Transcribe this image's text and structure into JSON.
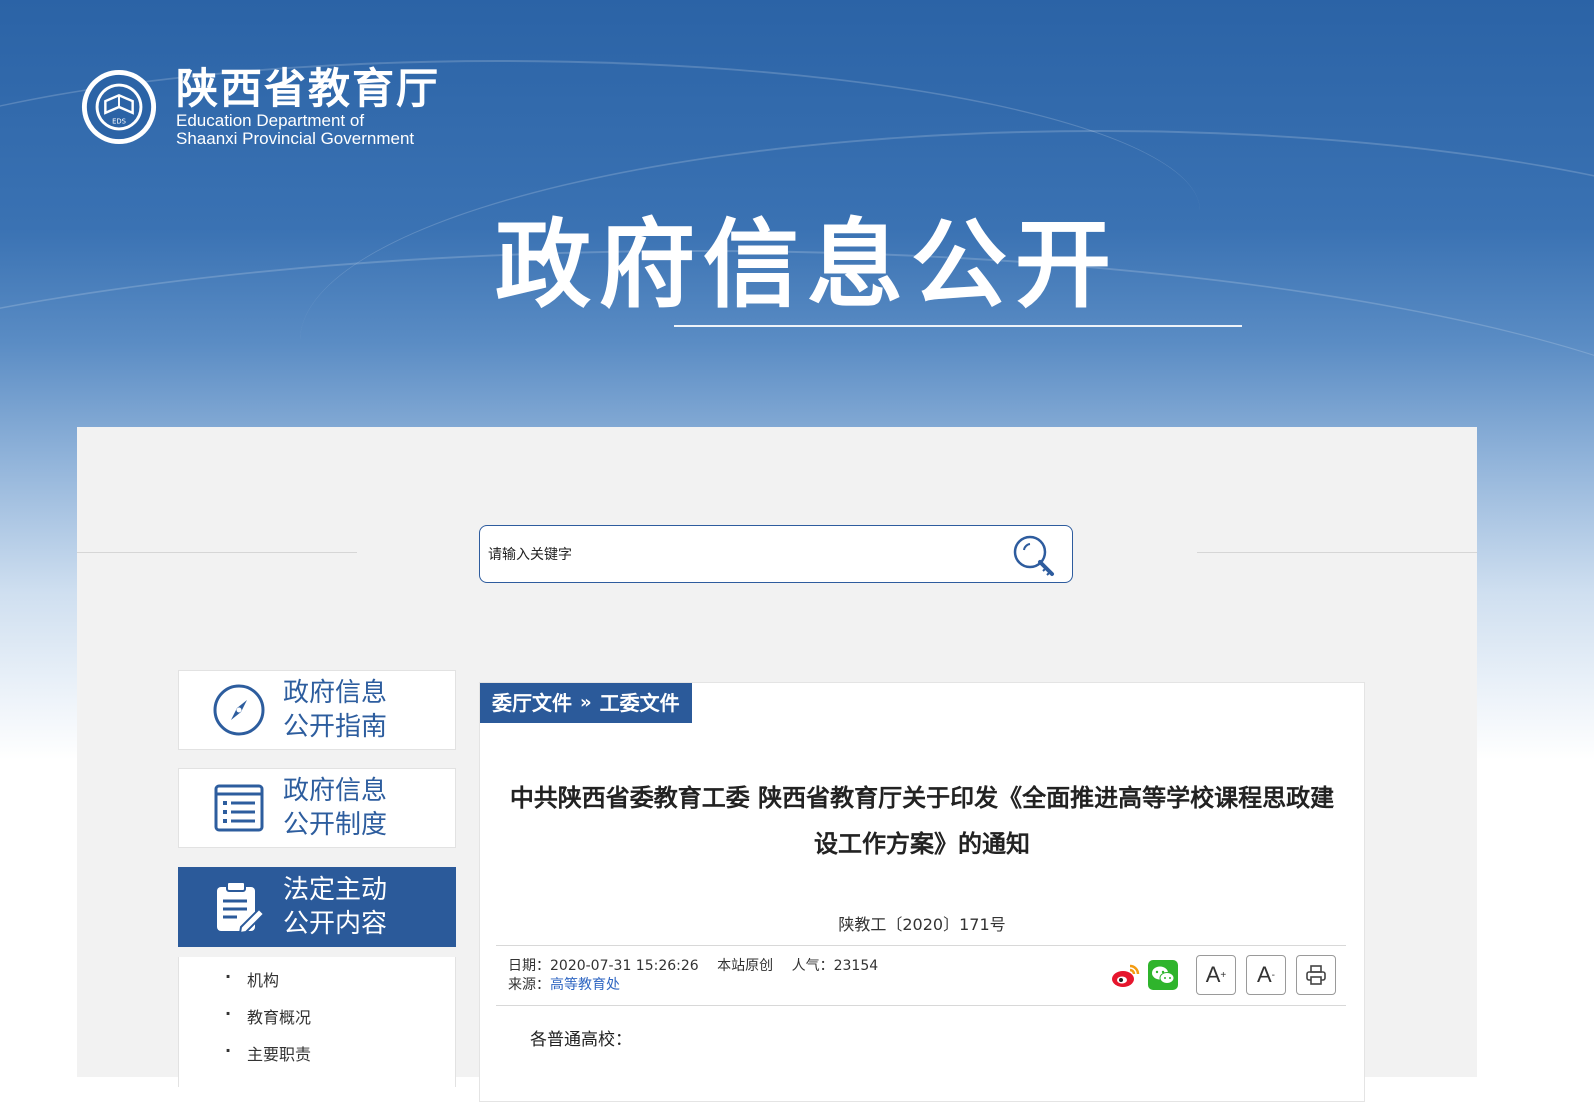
{
  "header": {
    "org_name_cn": "陕西省教育厅",
    "org_name_en_line1": "Education Department of",
    "org_name_en_line2": "Shaanxi Provincial Government",
    "emblem_text": "EDS",
    "banner_title": "政府信息公开"
  },
  "search": {
    "placeholder": "请输入关键字",
    "icon": "search-icon"
  },
  "sidebar": {
    "items": [
      {
        "label_line1": "政府信息",
        "label_line2": "公开指南",
        "icon": "compass-icon",
        "active": false
      },
      {
        "label_line1": "政府信息",
        "label_line2": "公开制度",
        "icon": "list-icon",
        "active": false
      },
      {
        "label_line1": "法定主动",
        "label_line2": "公开内容",
        "icon": "clipboard-edit-icon",
        "active": true
      }
    ],
    "sub_items": [
      "机构",
      "教育概况",
      "主要职责"
    ]
  },
  "article": {
    "breadcrumb": [
      "委厅文件",
      "工委文件"
    ],
    "breadcrumb_separator": "»",
    "title_line1": "中共陕西省委教育工委 陕西省教育厅关于印发《全面推进高等学校课程思政建",
    "title_line2": "设工作方案》的通知",
    "doc_number": "陕教工〔2020〕171号",
    "date_label": "日期：",
    "date": "2020-07-31 15:26:26",
    "origin": "本站原创",
    "views_label": "人气：",
    "views": "23154",
    "source_label": "来源：",
    "source": "高等教育处",
    "greeting": "各普通高校："
  },
  "tools": {
    "share_weibo": "weibo-icon",
    "share_wechat": "wechat-icon",
    "font_increase": "A",
    "font_decrease": "A",
    "print": "print-icon"
  },
  "colors": {
    "brand_blue": "#2b5a9a",
    "link_blue": "#2f66c2"
  }
}
